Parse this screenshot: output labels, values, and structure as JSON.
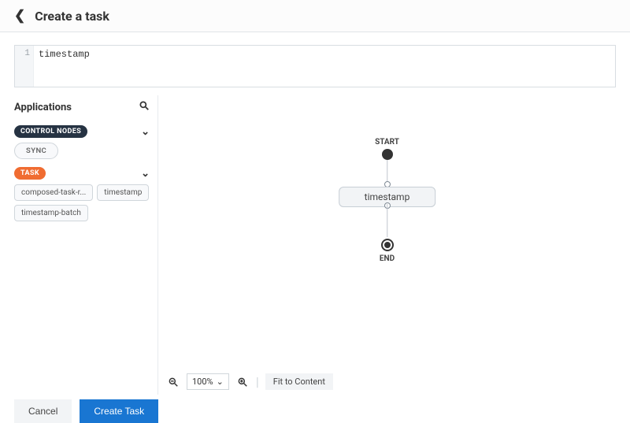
{
  "header": {
    "title": "Create a task"
  },
  "editor": {
    "line_number": "1",
    "content": "timestamp"
  },
  "sidebar": {
    "heading": "Applications",
    "groups": {
      "control": {
        "label": "CONTROL NODES",
        "items": [
          "SYNC"
        ]
      },
      "task": {
        "label": "TASK",
        "items": [
          "composed-task-r...",
          "timestamp",
          "timestamp-batch"
        ]
      }
    }
  },
  "canvas": {
    "start_label": "START",
    "end_label": "END",
    "node_label": "timestamp"
  },
  "toolbar": {
    "zoom_value": "100%",
    "fit_label": "Fit to Content"
  },
  "footer": {
    "cancel": "Cancel",
    "create": "Create Task"
  }
}
